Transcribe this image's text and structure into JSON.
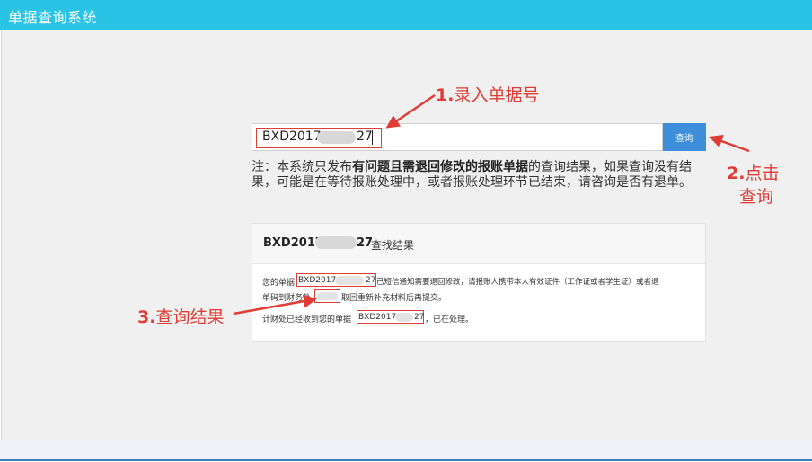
{
  "header": {
    "title": "单据查询系统"
  },
  "search": {
    "code_prefix": "BXD2017",
    "code_suffix": "27",
    "button_label": "查询"
  },
  "notice": {
    "prefix": "注：本系统只发布",
    "bold": "有问题且需退回修改的报账单据",
    "suffix": "的查询结果，如果查询没有结果，可能是在等待报账处理中，或者报账处理环节已结束，请咨询是否有退单。"
  },
  "result": {
    "code_prefix": "BXD2017",
    "code_suffix": "27",
    "title_suffix": "查找结果",
    "line1_a": "您的单据",
    "line1_code_prefix": "BXD2017",
    "line1_code_suffix": "27",
    "line1_b": "已短信通知需要退回修改，请报账人携带本人有效证件（工作证或者学生证）或者退",
    "line2_a": "单码到财务处",
    "line2_b": "取回重新补充材料后再提交。",
    "line3_a": "计财处已经收到您的单据",
    "line3_code_prefix": "BXD2017",
    "line3_code_suffix": "27",
    "line3_b": "，已在处理。"
  },
  "annotations": {
    "step1_num": "1.",
    "step1_text": "录入单据号",
    "step2_num": "2.",
    "step2_text_a": "点击",
    "step2_text_b": "查询",
    "step3_num": "3.",
    "step3_text": "查询结果"
  },
  "colors": {
    "header": "#29c3e6",
    "button": "#3d8fdb",
    "annotation": "#e03b35"
  }
}
